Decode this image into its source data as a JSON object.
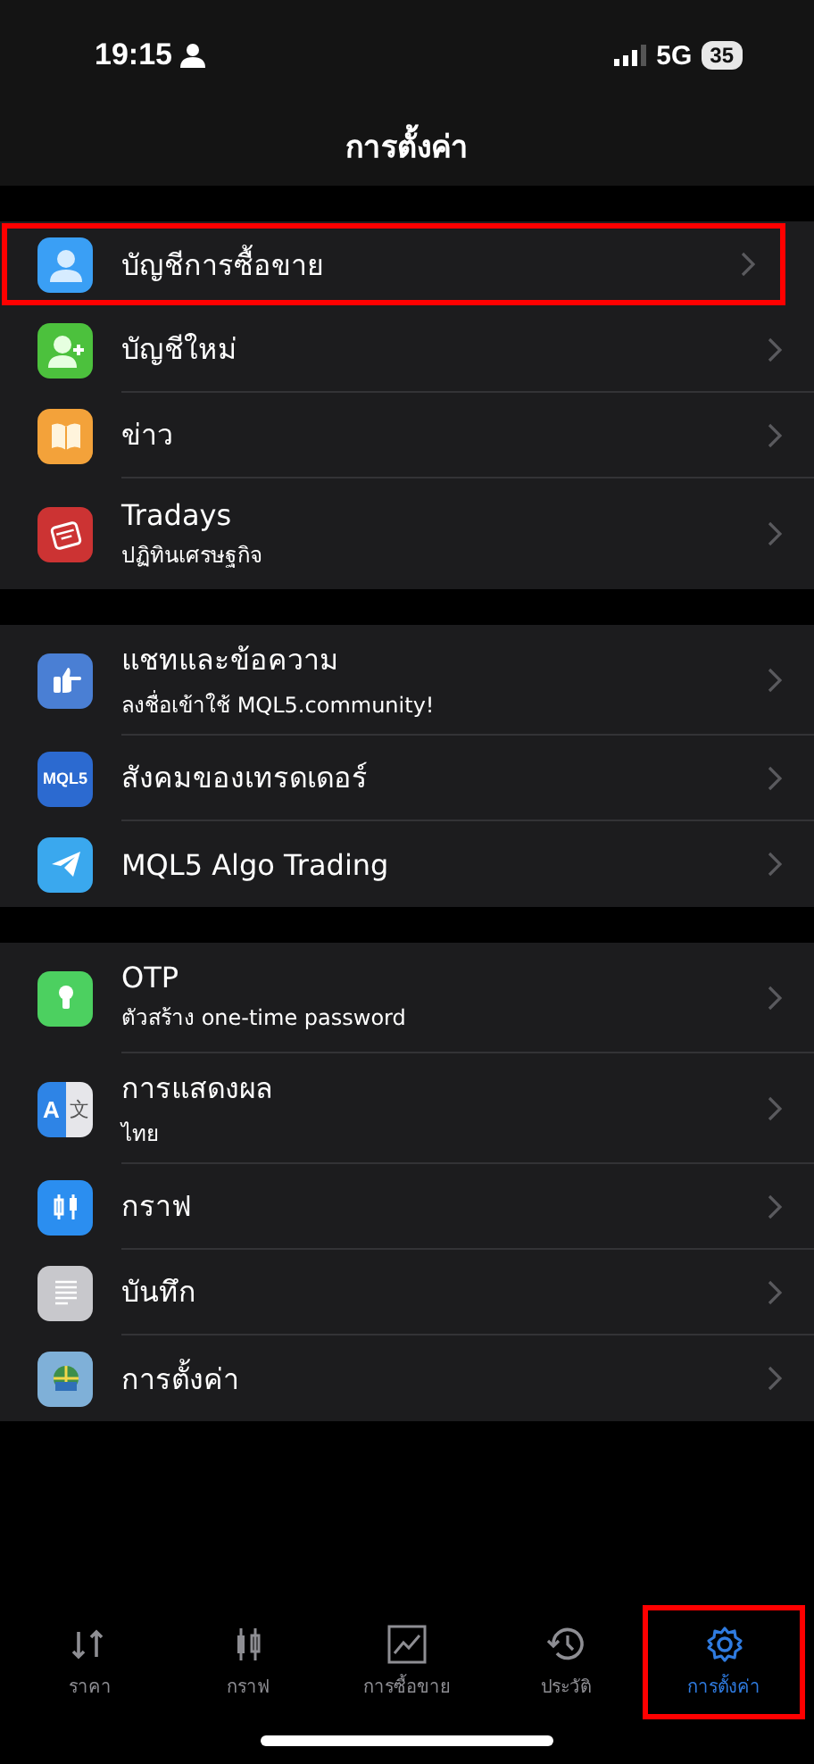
{
  "status_bar": {
    "time": "19:15",
    "network": "5G",
    "battery": "35"
  },
  "nav": {
    "title": "การตั้งค่า"
  },
  "sections": [
    {
      "items": [
        {
          "title": "บัญชีการซื้อขาย",
          "highlighted": true
        },
        {
          "title": "บัญชีใหม่",
          "highlighted": false
        },
        {
          "title": "ข่าว",
          "highlighted": false
        },
        {
          "title": "Tradays",
          "subtitle": "ปฏิทินเศรษฐกิจ",
          "highlighted": false
        }
      ]
    },
    {
      "items": [
        {
          "title": "แชทและข้อความ",
          "subtitle": "ลงชื่อเข้าใช้ MQL5.community!",
          "highlighted": false
        },
        {
          "title": "สังคมของเทรดเดอร์",
          "icon_text": [
            "MQL5"
          ],
          "highlighted": false
        },
        {
          "title": "MQL5 Algo Trading",
          "highlighted": false
        }
      ]
    },
    {
      "items": [
        {
          "title": "OTP",
          "subtitle": "ตัวสร้าง one-time password",
          "highlighted": false
        },
        {
          "title": "การแสดงผล",
          "subtitle": "ไทย",
          "icon_text": [
            "A",
            "文"
          ],
          "highlighted": false
        },
        {
          "title": "กราฟ",
          "highlighted": false
        },
        {
          "title": "บันทึก",
          "highlighted": false
        },
        {
          "title": "การตั้งค่า",
          "highlighted": false
        }
      ]
    }
  ],
  "tabs": [
    {
      "label": "ราคา",
      "selected": false,
      "highlighted": false
    },
    {
      "label": "กราฟ",
      "selected": false,
      "highlighted": false
    },
    {
      "label": "การซื้อขาย",
      "selected": false,
      "highlighted": false
    },
    {
      "label": "ประวัติ",
      "selected": false,
      "highlighted": false
    },
    {
      "label": "การตั้งค่า",
      "selected": true,
      "highlighted": true
    }
  ]
}
